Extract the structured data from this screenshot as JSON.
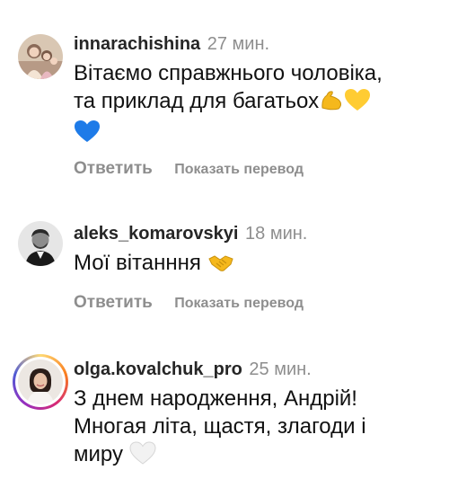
{
  "comments": [
    {
      "username": "innarachishina",
      "time": "27 мин.",
      "text_line1": "Вітаємо справжнього чоловіка,",
      "text_line2": "та приклад для багатьох",
      "emojis": [
        "flexed-biceps",
        "yellow-heart",
        "blue-heart"
      ],
      "reply_label": "Ответить",
      "translate_label": "Показать перевод"
    },
    {
      "username": "aleks_komarovskyi",
      "time": "18 мин.",
      "text_line1": "Мої вітанння",
      "emojis": [
        "handshake"
      ],
      "reply_label": "Ответить",
      "translate_label": "Показать перевод"
    },
    {
      "username": "olga.kovalchuk_pro",
      "time": "25 мин.",
      "text_line1": "З днем народження, Андрій!",
      "text_line2": "Многая літа, щастя, злагоди і",
      "text_line3": "миру",
      "emojis": [
        "white-heart"
      ],
      "has_story_ring": true
    }
  ]
}
